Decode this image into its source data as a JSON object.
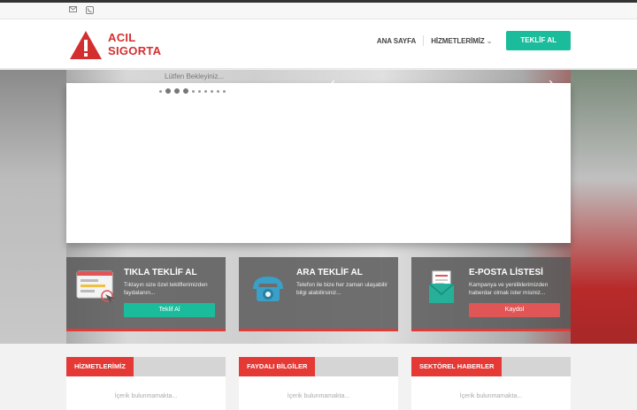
{
  "topbar": {
    "icons": [
      "mail-icon",
      "phone-icon"
    ]
  },
  "logo": {
    "line1": "ACIL",
    "line2": "SIGORTA"
  },
  "nav": {
    "home": "ANA SAYFA",
    "services": "HİZMETLERİMİZ",
    "chevron": "⌄",
    "cta": "TEKLİF AL"
  },
  "hero": {
    "loading": "Lütfen Bekleyiniz...",
    "prev": "‹",
    "next": "›",
    "dot_count": 10,
    "active_dot": 3
  },
  "cards": [
    {
      "title": "TIKLA TEKLİF AL",
      "text": "Tıklayın size özel tekliflerimizden faydalanın...",
      "button": "Teklif Al",
      "color": "#1abc9c",
      "icon": "form-click-icon"
    },
    {
      "title": "ARA TEKLİF AL",
      "text": "Telefon ile bize her zaman ulaşabilir bilgi alabilirsiniz...",
      "button": "",
      "color": "#1abc9c",
      "icon": "telephone-icon"
    },
    {
      "title": "E-POSTA LİSTESİ",
      "text": "Kampanya ve yeniliklerimizden haberdar olmak ister misiniz...",
      "button": "Kaydol",
      "color": "#e05555",
      "icon": "envelope-letter-icon"
    }
  ],
  "boxes": [
    {
      "title": "HİZMETLERİMİZ",
      "msg": "İçerik bulunmamakta..."
    },
    {
      "title": "FAYDALI BİLGİLER",
      "msg": "İçerik bulunmamakta..."
    },
    {
      "title": "SEKTÖREL HABERLER",
      "msg": "İçerik bulunmamakta..."
    }
  ],
  "colors": {
    "accent": "#1abc9c",
    "brand": "#d32f2f",
    "red": "#e53935"
  }
}
